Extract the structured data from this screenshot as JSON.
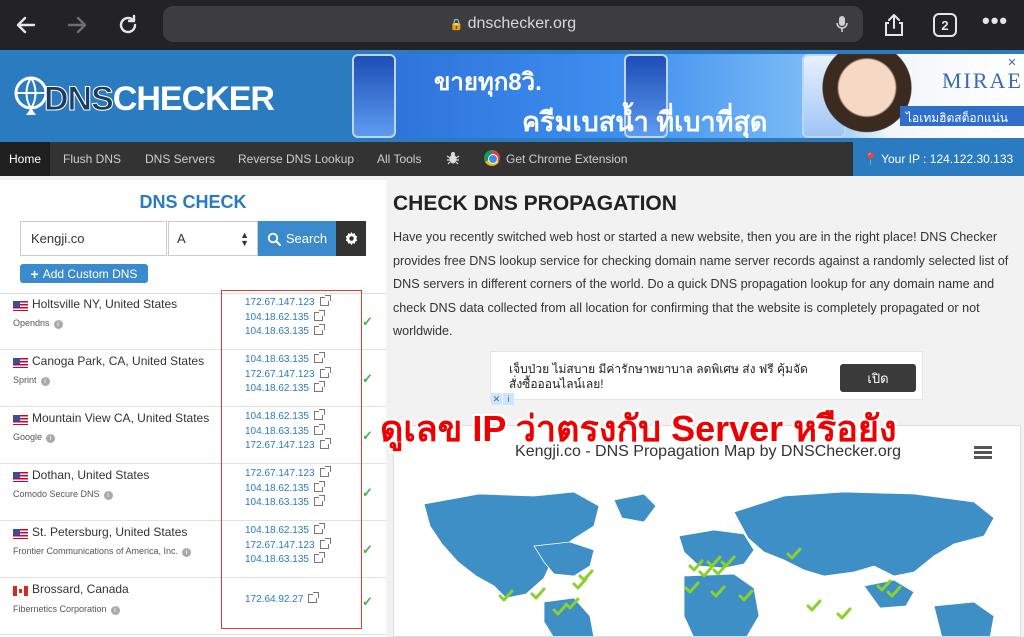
{
  "browser": {
    "url": "dnschecker.org",
    "tab_count": "2"
  },
  "header": {
    "logo_dns": "DNS",
    "logo_checker": "CHECKER",
    "ad_line1": "ขายทุก8วิ.",
    "ad_line2": "ครีมเบสน้ำ   ที่เบาที่สุด",
    "ad_brand": "MIRAE",
    "ad_cta": "ไอเทมฮิตสต็อกแน่น"
  },
  "nav": {
    "items": [
      "Home",
      "Flush DNS",
      "DNS Servers",
      "Reverse DNS Lookup",
      "All Tools",
      "Get Chrome Extension"
    ],
    "your_ip": "Your IP : 124.122.30.133"
  },
  "dns_check": {
    "title": "DNS CHECK",
    "domain_value": "Kengji.co",
    "record_type": "A",
    "search_label": "Search",
    "add_custom_label": "Add Custom DNS",
    "results": [
      {
        "flag": "us",
        "location": "Holtsville NY, United States",
        "provider": "Opendns",
        "ips": [
          "172.67.147.123",
          "104.18.62.135",
          "104.18.63.135"
        ]
      },
      {
        "flag": "us",
        "location": "Canoga Park, CA, United States",
        "provider": "Sprint",
        "ips": [
          "104.18.63.135",
          "172.67.147.123",
          "104.18.62.135"
        ]
      },
      {
        "flag": "us",
        "location": "Mountain View CA, United States",
        "provider": "Google",
        "ips": [
          "104.18.62.135",
          "104.18.63.135",
          "172.67.147.123"
        ]
      },
      {
        "flag": "us",
        "location": "Dothan, United States",
        "provider": "Comodo Secure DNS",
        "ips": [
          "172.67.147.123",
          "104.18.62.135",
          "104.18.63.135"
        ]
      },
      {
        "flag": "us",
        "location": "St. Petersburg, United States",
        "provider": "Frontier Communications of America, Inc.",
        "ips": [
          "104.18.62.135",
          "172.67.147.123",
          "104.18.63.135"
        ]
      },
      {
        "flag": "ca",
        "location": "Brossard, Canada",
        "provider": "Fibernetics Corporation",
        "ips": [
          "172.64.92.27"
        ]
      }
    ]
  },
  "main": {
    "title": "CHECK DNS PROPAGATION",
    "intro": "Have you recently switched web host or started a new website, then you are in the right place! DNS Checker provides free DNS lookup service for checking domain name server records against a randomly selected list of DNS servers in different corners of the world. Do a quick DNS propagation lookup for any domain name and check DNS data collected from all location for confirming that the website is completely propagated or not worldwide.",
    "ad_text": "เจ็บป่วย ไม่สบาย มีค่ารักษาพยาบาล ลดพิเศษ ส่ง ฟรี คุ้มจัด สั่งซื้อออนไลน์เลย!",
    "ad_button": "เปิด",
    "overlay_note": "ดูเลข IP ว่าตรงกับ Server หรือยัง",
    "map_title": "Kengji.co - DNS Propagation Map by DNSChecker.org"
  },
  "colors": {
    "brand_blue": "#2a7bbf",
    "check_green": "#4cae4c",
    "annotation_red": "#e00"
  }
}
